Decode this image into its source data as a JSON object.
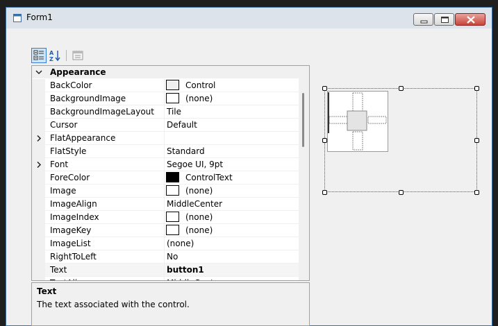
{
  "window": {
    "title": "Form1"
  },
  "icons": {
    "categorized": "categorized-icon",
    "alphabetical": "alphabetical-sort-icon",
    "property_pages": "property-pages-icon"
  },
  "grid": {
    "category": "Appearance",
    "rows": [
      {
        "name": "BackColor",
        "value": "Control",
        "swatch": "#f0f0f0",
        "expandable": false
      },
      {
        "name": "BackgroundImage",
        "value": "(none)",
        "swatch": "#ffffff",
        "expandable": false
      },
      {
        "name": "BackgroundImageLayout",
        "value": "Tile",
        "expandable": false
      },
      {
        "name": "Cursor",
        "value": "Default",
        "expandable": false
      },
      {
        "name": "FlatAppearance",
        "value": "",
        "expandable": true
      },
      {
        "name": "FlatStyle",
        "value": "Standard",
        "expandable": false
      },
      {
        "name": "Font",
        "value": "Segoe UI, 9pt",
        "expandable": true
      },
      {
        "name": "ForeColor",
        "value": "ControlText",
        "swatch": "#000000",
        "expandable": false
      },
      {
        "name": "Image",
        "value": "(none)",
        "swatch": "#ffffff",
        "expandable": false
      },
      {
        "name": "ImageAlign",
        "value": "MiddleCenter",
        "expandable": false
      },
      {
        "name": "ImageIndex",
        "value": "(none)",
        "swatch": "#ffffff",
        "expandable": false
      },
      {
        "name": "ImageKey",
        "value": "(none)",
        "swatch": "#ffffff",
        "expandable": false
      },
      {
        "name": "ImageList",
        "value": "(none)",
        "expandable": false
      },
      {
        "name": "RightToLeft",
        "value": "No",
        "expandable": false
      },
      {
        "name": "Text",
        "value": "button1",
        "bold": true,
        "highlight": true,
        "expandable": false
      },
      {
        "name": "TextAlign",
        "value": "MiddleCenter",
        "expandable": false
      }
    ]
  },
  "description": {
    "title": "Text",
    "body": "The text associated with the control."
  },
  "colors": {
    "accent": "#3a7bd5",
    "window_border": "#3a6ea5"
  }
}
